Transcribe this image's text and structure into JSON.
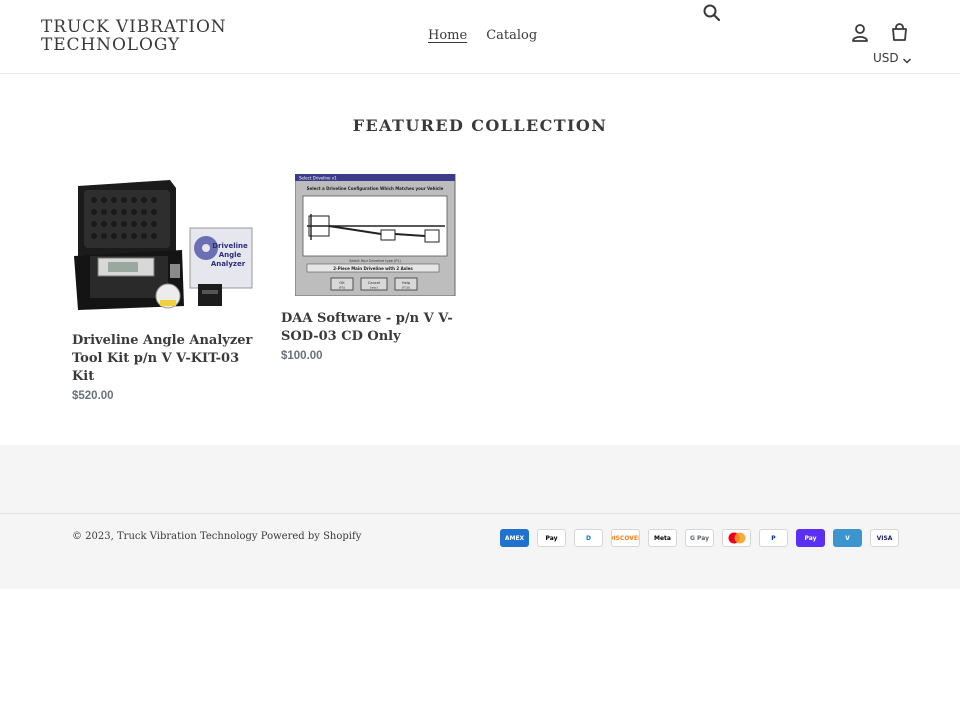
{
  "header": {
    "logo": "TRUCK VIBRATION TECHNOLOGY",
    "nav": [
      {
        "label": "Home",
        "active": true
      },
      {
        "label": "Catalog",
        "active": false
      }
    ],
    "currency": "USD"
  },
  "featured": {
    "title": "FEATURED COLLECTION",
    "products": [
      {
        "title": "Driveline Angle Analyzer Tool Kit p/n V V-KIT-03 Kit",
        "price": "$520.00"
      },
      {
        "title": "DAA Software - p/n V V-SOD-03 CD Only",
        "price": "$100.00"
      }
    ],
    "software_image_text": {
      "window_title": "Select Driveline v1",
      "heading": "Select a Driveline Configuration Which Matches your Vehicle",
      "caption": "Select Your Driveline type (P1)",
      "selection": "2-Piece Main Driveline with 2 Axles",
      "ok": "OK",
      "cancel": "Cancel",
      "help": "Help",
      "ok_key": "(F5)",
      "cancel_key": "(esc)",
      "help_key": "(F10)"
    },
    "kit_image_text": {
      "cd_label": "Driveline Angle Analyzer"
    }
  },
  "footer": {
    "copyright_prefix": "© 2023,",
    "store_link": "Truck Vibration Technology",
    "powered": "Powered by Shopify",
    "payments": [
      {
        "name": "amex-icon",
        "label": "AMEX",
        "color": "#1f72cd"
      },
      {
        "name": "apple-pay-icon",
        "label": "Pay",
        "color": "#000000"
      },
      {
        "name": "diners-club-icon",
        "label": "D",
        "color": "#0079be"
      },
      {
        "name": "discover-icon",
        "label": "DISCOVER",
        "color": "#f48120"
      },
      {
        "name": "meta-pay-icon",
        "label": "Meta",
        "color": "#000000"
      },
      {
        "name": "google-pay-icon",
        "label": "G Pay",
        "color": "#5f6368"
      },
      {
        "name": "mastercard-icon",
        "label": "",
        "color": "#eb001b"
      },
      {
        "name": "paypal-icon",
        "label": "P",
        "color": "#003087"
      },
      {
        "name": "shop-pay-icon",
        "label": "Pay",
        "color": "#5a31f4"
      },
      {
        "name": "venmo-icon",
        "label": "V",
        "color": "#3d95ce"
      },
      {
        "name": "visa-icon",
        "label": "VISA",
        "color": "#1a1f71"
      }
    ]
  }
}
